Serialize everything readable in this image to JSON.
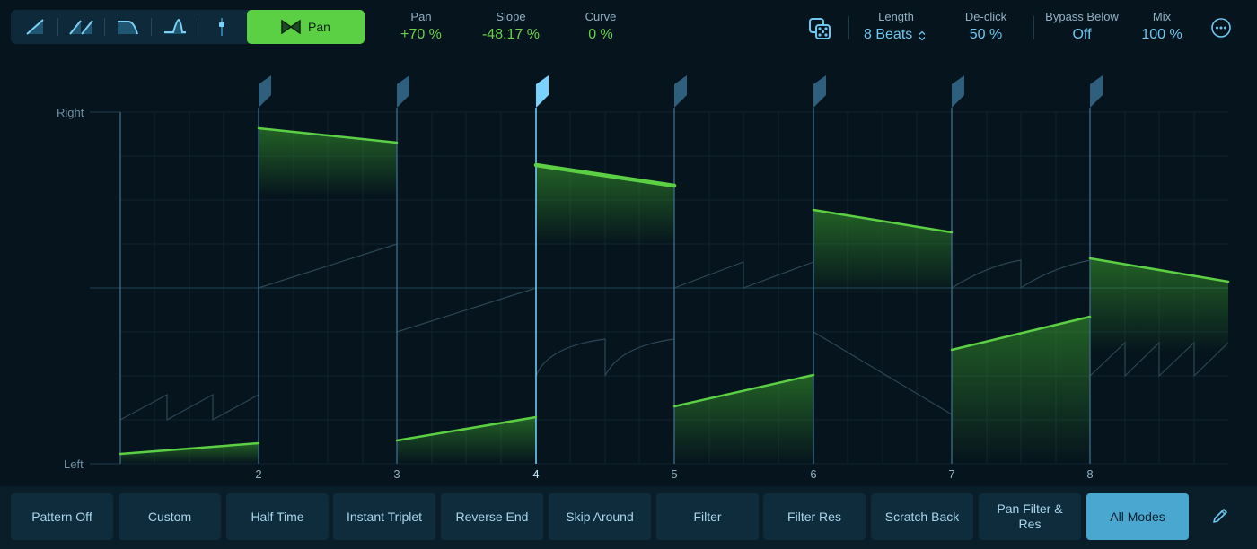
{
  "toolbar": {
    "shape_buttons": [
      {
        "icon": "ramp-shape-icon"
      },
      {
        "icon": "double-ramp-shape-icon"
      },
      {
        "icon": "lowpass-shape-icon"
      },
      {
        "icon": "peak-shape-icon"
      },
      {
        "icon": "fader-shape-icon"
      }
    ],
    "pan_button": {
      "label": "Pan",
      "icon": "pan-bowtie-icon"
    },
    "params": {
      "pan": {
        "label": "Pan",
        "value": "+70 %"
      },
      "slope": {
        "label": "Slope",
        "value": "-48.17 %"
      },
      "curve": {
        "label": "Curve",
        "value": "0 %"
      },
      "length": {
        "label": "Length",
        "value": "8 Beats"
      },
      "declick": {
        "label": "De-click",
        "value": "50 %"
      },
      "bypass": {
        "label": "Bypass Below",
        "value": "Off"
      },
      "mix": {
        "label": "Mix",
        "value": "100 %"
      }
    },
    "icons": {
      "dice": "dice-icon",
      "more": "more-options-icon",
      "stepper": "stepper-icon"
    }
  },
  "graph": {
    "y_labels": {
      "top": "Right",
      "bottom": "Left"
    },
    "beat_labels": [
      "2",
      "3",
      "4",
      "5",
      "6",
      "7",
      "8"
    ],
    "selected_beat": "4",
    "colors": {
      "accent_green": "#5cd044",
      "accent_blue": "#6cc8f0",
      "grid": "#132a38",
      "divider": "#3b6f8c",
      "flag": "#2e5f7c",
      "flag_selected": "#7ad3ff"
    }
  },
  "modes": {
    "buttons": [
      "Pattern Off",
      "Custom",
      "Half Time",
      "Instant Triplet",
      "Reverse End",
      "Skip Around",
      "Filter",
      "Filter Res",
      "Scratch Back",
      "Pan Filter & Res",
      "All Modes"
    ],
    "selected": "All Modes",
    "edit_icon": "pencil-icon"
  }
}
